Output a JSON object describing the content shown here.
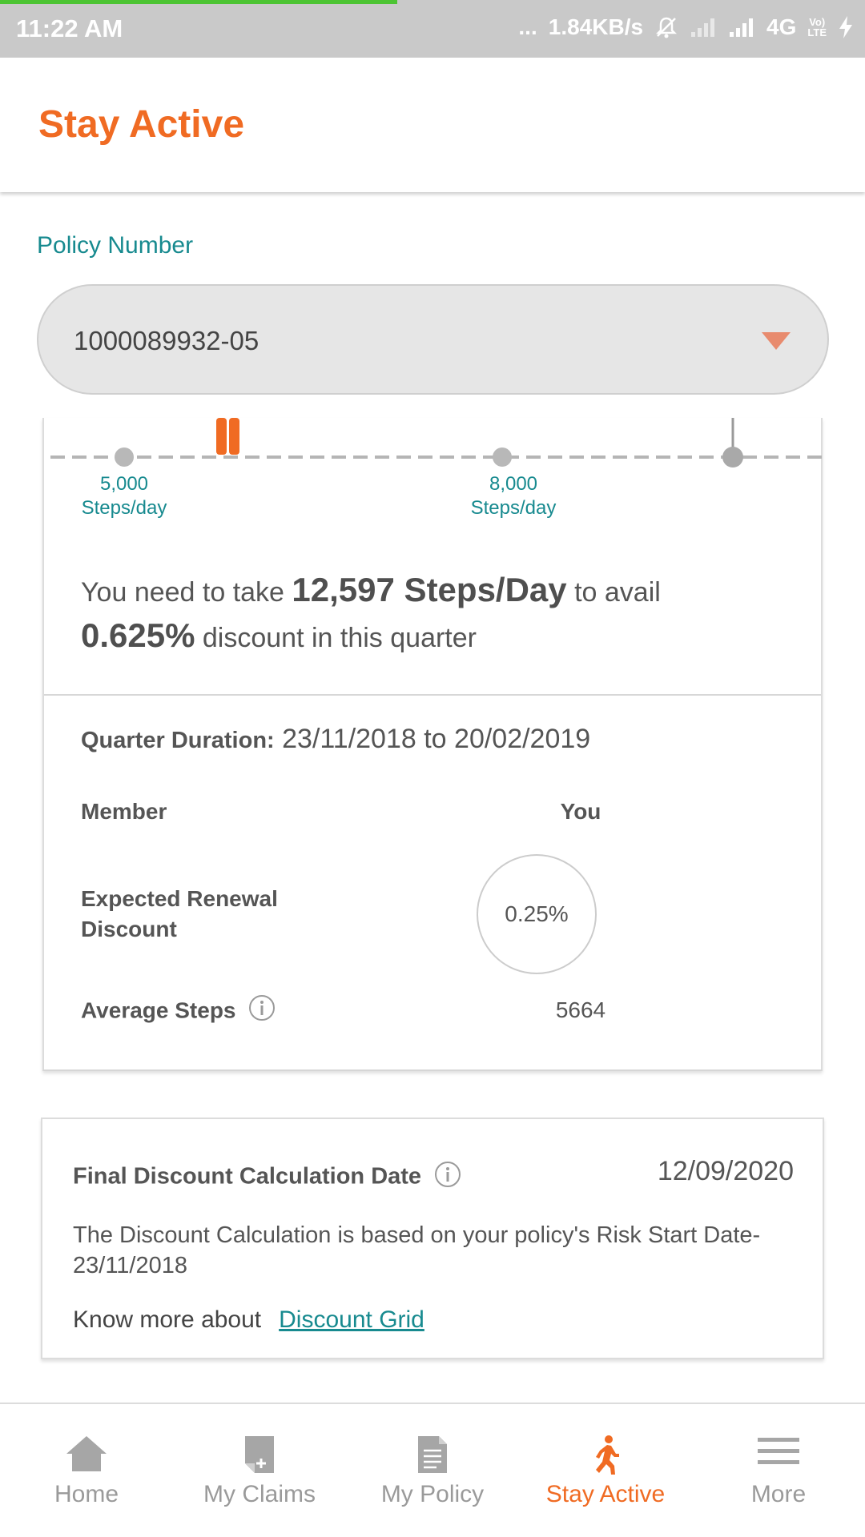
{
  "status_bar": {
    "time": "11:22 AM",
    "network_speed": "1.84KB/s",
    "network_type": "4G",
    "volte_top": "Vo)",
    "volte_bottom": "LTE",
    "dots": "..."
  },
  "header": {
    "title": "Stay Active"
  },
  "policy": {
    "label": "Policy Number",
    "selected": "1000089932-05"
  },
  "tracker": {
    "milestones": [
      {
        "steps": "5,000",
        "unit": "Steps/day"
      },
      {
        "steps": "8,000",
        "unit": "Steps/day"
      }
    ]
  },
  "target": {
    "prefix": "You need to take ",
    "steps": "12,597 Steps/Day",
    "middle": " to avail ",
    "discount": "0.625%",
    "suffix": " discount in this quarter"
  },
  "quarter": {
    "label": "Quarter Duration:",
    "value": "23/11/2018 to 20/02/2019"
  },
  "summary": {
    "member_label": "Member",
    "member_value": "You",
    "renewal_label_line1": "Expected Renewal",
    "renewal_label_line2": "Discount",
    "renewal_value": "0.25%",
    "avg_steps_label": "Average Steps",
    "avg_steps_value": "5664"
  },
  "final": {
    "label": "Final Discount Calculation Date",
    "date": "12/09/2020",
    "basis": "The Discount Calculation is based on your policy's Risk Start Date- 23/11/2018",
    "know_more": "Know more about",
    "link": "Discount Grid"
  },
  "bottom_nav": {
    "items": [
      {
        "label": "Home",
        "icon": "home-icon"
      },
      {
        "label": "My Claims",
        "icon": "claims-icon"
      },
      {
        "label": "My Policy",
        "icon": "policy-document-icon"
      },
      {
        "label": "Stay Active",
        "icon": "running-person-icon",
        "active": true
      },
      {
        "label": "More",
        "icon": "hamburger-menu-icon"
      }
    ]
  },
  "colors": {
    "brand": "#f06b23",
    "teal": "#178a8f",
    "statusbar": "#c9c9c9",
    "loadbar": "#4cc433"
  }
}
